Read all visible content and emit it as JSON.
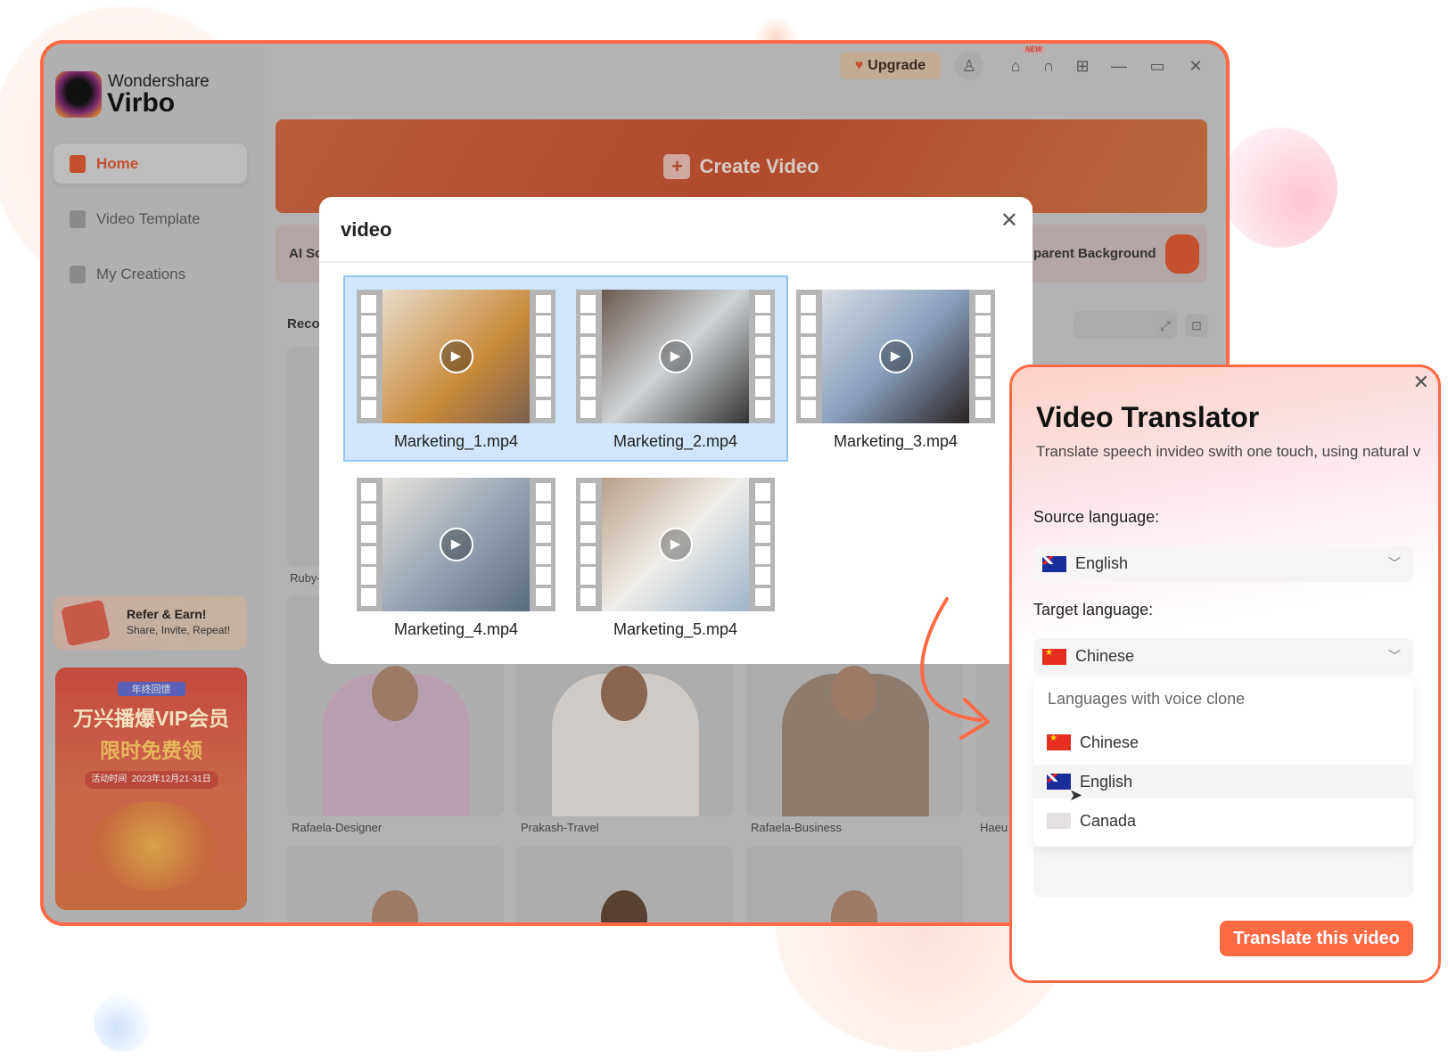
{
  "app": {
    "brand_top": "Wondershare",
    "brand_name": "Virbo"
  },
  "sidebar": {
    "items": [
      {
        "label": "Home",
        "active": true
      },
      {
        "label": "Video Template"
      },
      {
        "label": "My Creations"
      }
    ],
    "refer": {
      "title": "Refer & Earn!",
      "subtitle": "Share, Invite, Repeat!"
    },
    "promo": {
      "tag": "年终回馈",
      "line1": "万兴播爆VIP会员",
      "line2": "限时免费领",
      "date_label": "活动时间",
      "date": "2023年12月21-31日"
    }
  },
  "topbar": {
    "upgrade": "Upgrade",
    "new_badge": "NEW"
  },
  "main": {
    "create_video": "Create Video",
    "card_left": "AI Sc",
    "card_right": "parent Background",
    "recommend_label": "Reco",
    "avatars": [
      "Ruby-",
      "Rafaela-Designer",
      "Prakash-Travel",
      "Rafaela-Business",
      "Haeu"
    ]
  },
  "video_dialog": {
    "title": "video",
    "files": [
      "Marketing_1.mp4",
      "Marketing_2.mp4",
      "Marketing_3.mp4",
      "Marketing_4.mp4",
      "Marketing_5.mp4"
    ]
  },
  "translator": {
    "title": "Video Translator",
    "subtitle": "Translate speech invideo swith one touch, using natural v",
    "source_label": "Source language:",
    "source_value": "English",
    "target_label": "Target language:",
    "target_value": "Chinese",
    "dropdown": {
      "header": "Languages with voice clone",
      "options": [
        "Chinese",
        "English",
        "Canada"
      ]
    },
    "button": "Translate this video"
  },
  "colors": {
    "accent": "#ff6a45",
    "selection": "#cfe6fc"
  }
}
